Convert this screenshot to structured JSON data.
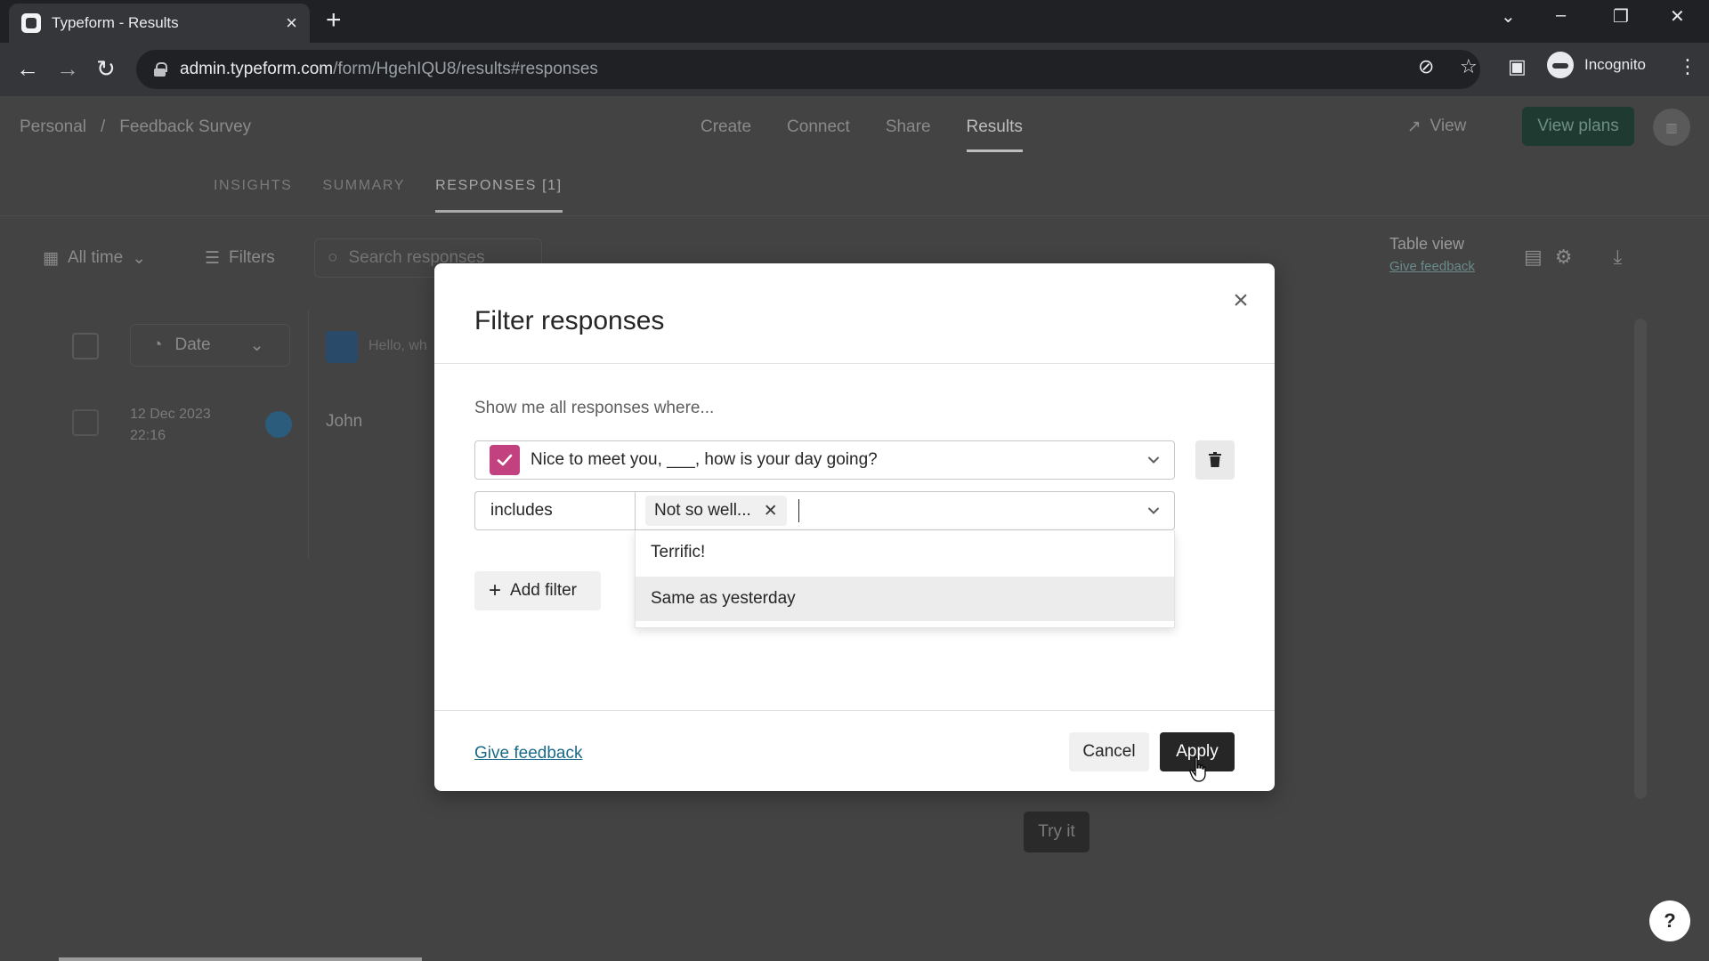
{
  "browser": {
    "tab_title": "Typeform - Results",
    "url_host": "admin.typeform.com",
    "url_path": "/form/HgehIQU8/results#responses",
    "incognito_label": "Incognito"
  },
  "app": {
    "breadcrumb": [
      "Personal",
      "Feedback Survey"
    ],
    "breadcrumb_sep": "/",
    "nav": [
      "Create",
      "Connect",
      "Share",
      "Results"
    ],
    "view_label": "View",
    "view_plans_label": "View plans",
    "subtabs": [
      "INSIGHTS",
      "SUMMARY",
      "RESPONSES [1]"
    ],
    "all_time_label": "All time",
    "filters_label": "Filters",
    "search_placeholder": "Search responses",
    "table_view_label": "Table view",
    "table_view_feedback": "Give feedback",
    "date_column_label": "Date",
    "question_column_label": "Hello, wh",
    "row": {
      "date": "12 Dec 2023",
      "time": "22:16",
      "name": "John"
    },
    "try_it_label": "Try it",
    "help_label": "?"
  },
  "modal": {
    "title": "Filter responses",
    "subtitle": "Show me all responses where...",
    "question": "Nice to meet you, ___, how is your day going?",
    "condition": "includes",
    "selected_chip": "Not so well...",
    "options": [
      "Terrific!",
      "Same as yesterday"
    ],
    "add_filter_label": "Add filter",
    "give_feedback_label": "Give feedback",
    "cancel_label": "Cancel",
    "apply_label": "Apply"
  },
  "colors": {
    "accent_check": "#c2417f",
    "apply_bg": "#262627",
    "link": "#1a6a8a"
  }
}
